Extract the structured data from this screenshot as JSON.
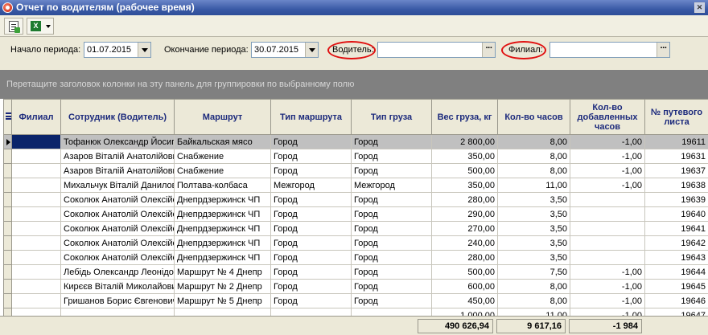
{
  "window": {
    "title": "Отчет по водителям (рабочее время)"
  },
  "toolbar": {
    "report_icon": "report-icon",
    "excel_icon": "excel-export-icon"
  },
  "filters": {
    "start_label": "Начало периода:",
    "start_value": "01.07.2015",
    "end_label": "Окончание периода:",
    "end_value": "30.07.2015",
    "driver_label": "Водитель:",
    "driver_value": "",
    "branch_label": "Филиал:",
    "branch_value": "",
    "ellipsis": "···",
    "highlight_color": "#e01010"
  },
  "group_panel": {
    "hint": "Перетащите заголовок колонки на эту панель для группировки по выбранному полю"
  },
  "table": {
    "columns": [
      "Филиал",
      "Сотрудник (Водитель)",
      "Маршрут",
      "Тип маршрута",
      "Тип груза",
      "Вес груза, кг",
      "Кол-во часов",
      "Кол-во добавленных часов",
      "№ путевого листа"
    ],
    "rows": [
      [
        "",
        "Тофанюк Олександр Йосипович",
        "Байкальская мясо",
        "Город",
        "Город",
        "2 800,00",
        "8,00",
        "-1,00",
        "19611"
      ],
      [
        "",
        "Азаров Віталій Анатолійович",
        "Снабжение",
        "Город",
        "Город",
        "350,00",
        "8,00",
        "-1,00",
        "19631"
      ],
      [
        "",
        "Азаров Віталій Анатолійович",
        "Снабжение",
        "Город",
        "Город",
        "500,00",
        "8,00",
        "-1,00",
        "19637"
      ],
      [
        "",
        "Михальчук Віталій Данилович",
        "Полтава-колбаса",
        "Межгород",
        "Межгород",
        "350,00",
        "11,00",
        "-1,00",
        "19638"
      ],
      [
        "",
        "Соколюк Анатолій Олексійович",
        "Днепрдзержинск ЧП",
        "Город",
        "Город",
        "280,00",
        "3,50",
        "",
        "19639"
      ],
      [
        "",
        "Соколюк Анатолій Олексійович",
        "Днепрдзержинск ЧП",
        "Город",
        "Город",
        "290,00",
        "3,50",
        "",
        "19640"
      ],
      [
        "",
        "Соколюк Анатолій Олексійович",
        "Днепрдзержинск ЧП",
        "Город",
        "Город",
        "270,00",
        "3,50",
        "",
        "19641"
      ],
      [
        "",
        "Соколюк Анатолій Олексійович",
        "Днепрдзержинск ЧП",
        "Город",
        "Город",
        "240,00",
        "3,50",
        "",
        "19642"
      ],
      [
        "",
        "Соколюк Анатолій Олексійович",
        "Днепрдзержинск ЧП",
        "Город",
        "Город",
        "280,00",
        "3,50",
        "",
        "19643"
      ],
      [
        "",
        "Лебідь Олександр Леонідович",
        "Маршрут № 4 Днепр",
        "Город",
        "Город",
        "500,00",
        "7,50",
        "-1,00",
        "19644"
      ],
      [
        "",
        "Кирєєв Віталій Миколайович",
        "Маршрут № 2 Днепр",
        "Город",
        "Город",
        "600,00",
        "8,00",
        "-1,00",
        "19645"
      ],
      [
        "",
        "Гришанов Борис Євгенович",
        "Маршрут № 5 Днепр",
        "Город",
        "Город",
        "450,00",
        "8,00",
        "-1,00",
        "19646"
      ],
      [
        "",
        "",
        "",
        "",
        "",
        "1 000,00",
        "11,00",
        "-1,00",
        "19647"
      ]
    ]
  },
  "totals": {
    "weight": "490 626,94",
    "hours": "9 617,16",
    "added_hours": "-1 984"
  }
}
